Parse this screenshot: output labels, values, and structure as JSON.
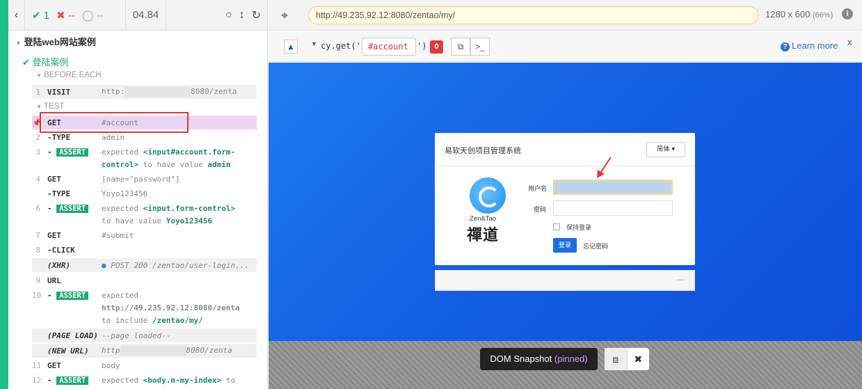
{
  "reporter": {
    "passed": "1",
    "failed": "--",
    "pending": "--",
    "duration": "04.84",
    "suite_title": "登陆web网站案例",
    "test_title": "登陆案例",
    "before_each": "BEFORE EACH",
    "test_label": "TEST",
    "rows": {
      "r1": {
        "num": "1",
        "name": "VISIT",
        "msg_a": "http:",
        "msg_b": "8080/zenta"
      },
      "r_get": {
        "num": "",
        "name": "GET",
        "msg": "#account"
      },
      "r2": {
        "num": "2",
        "name": "-TYPE",
        "msg": "admin"
      },
      "r3": {
        "num": "3",
        "badge": "ASSERT",
        "l1a": "expected",
        "l1b": "<input#account.form-",
        "l2a": "control>",
        "l2b": "to have value",
        "l2c": "admin"
      },
      "r4": {
        "num": "4",
        "name": "GET",
        "msg": "[name=\"password\"]"
      },
      "r5": {
        "num": "",
        "name": "-TYPE",
        "msg": "Yoyo123456"
      },
      "r6": {
        "num": "6",
        "badge": "ASSERT",
        "l1a": "expected",
        "l1b": "<input.form-control>",
        "l2a": "to have value",
        "l2b": "Yoyo123456"
      },
      "r7": {
        "num": "7",
        "name": "GET",
        "msg": "#submit"
      },
      "r8": {
        "num": "8",
        "name": "-CLICK"
      },
      "rxhr": {
        "name": "(XHR)",
        "msg": "POST 200 /zentao/user-login..."
      },
      "r9": {
        "num": "9",
        "name": "URL"
      },
      "r10": {
        "num": "10",
        "badge": "ASSERT",
        "l1": "expected",
        "l2": "http://49.235.92.12:8080/zenta",
        "l3a": "to include",
        "l3b": "/zentao/my/"
      },
      "rpl": {
        "name": "(PAGE LOAD)",
        "msg": "--page loaded--"
      },
      "rnu": {
        "name": "(NEW URL)",
        "msg_a": "http",
        "msg_b": "8080/zenta"
      },
      "r11": {
        "num": "11",
        "name": "GET",
        "msg": "body"
      },
      "r12": {
        "num": "12",
        "badge": "ASSERT",
        "l1a": "expected",
        "l1b": "<body.m-my-index>",
        "l1c": "to"
      }
    }
  },
  "aut": {
    "url": "http://49.235.92.12:8080/zentao/my/",
    "viewport": "1280 x 600",
    "zoom": "(66%)",
    "selector": {
      "prefix": "cy.get('",
      "value": "#account",
      "suffix": "')",
      "count": "0",
      "learn_more": "Learn more",
      "close": "x"
    },
    "login": {
      "title": "易软天创项目管理系统",
      "lang": "简体 ▾",
      "logo_text": "Zen&Tao",
      "logo_cn": "禪道",
      "user_label": "用户名",
      "pass_label": "密码",
      "remember": "保持登录",
      "login_btn": "登录",
      "forgot": "忘记密码",
      "footer_dash": "—"
    },
    "snapshot": {
      "label": "DOM Snapshot",
      "state": "(pinned)"
    }
  },
  "colors": {
    "pass": "#1fa971",
    "fail": "#e94f4f",
    "app_bg": "#1360e4",
    "pin_highlight": "#ead6f2"
  }
}
